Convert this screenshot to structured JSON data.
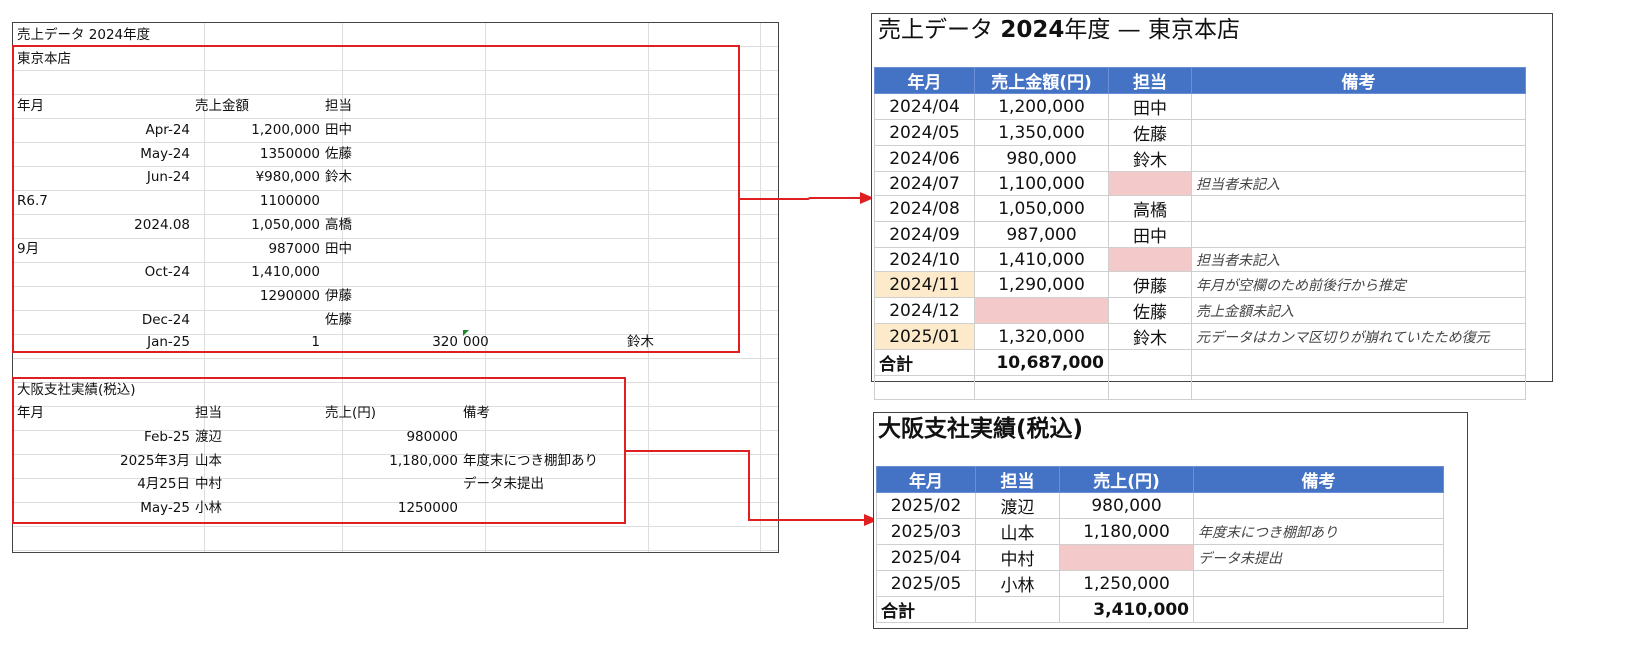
{
  "raw": {
    "title": "売上データ 2024年度",
    "tokyo_label": "東京本店",
    "tokyo_headers": [
      "年月",
      "売上金額",
      "担当"
    ],
    "tokyo_rows": [
      {
        "a": "Apr-24",
        "a_align": "r",
        "b": "1,200,000",
        "c": "田中"
      },
      {
        "a": "May-24",
        "a_align": "r",
        "b": "1350000",
        "c": "佐藤"
      },
      {
        "a": "Jun-24",
        "a_align": "r",
        "b": "¥980,000",
        "c": "鈴木"
      },
      {
        "a": "R6.7",
        "a_align": "l",
        "b": "1100000",
        "c": ""
      },
      {
        "a": "2024.08",
        "a_align": "r",
        "b": "1,050,000",
        "c": "高橋"
      },
      {
        "a": "9月",
        "a_align": "l",
        "b": "987000",
        "c": "田中"
      },
      {
        "a": "Oct-24",
        "a_align": "r",
        "b": "1,410,000",
        "c": ""
      },
      {
        "a": "",
        "a_align": "r",
        "b": "1290000",
        "c": "伊藤"
      },
      {
        "a": "Dec-24",
        "a_align": "r",
        "b": "",
        "c": "佐藤"
      }
    ],
    "jan_row": {
      "a": "Jan-25",
      "b": "1",
      "c": "320",
      "d": "000",
      "e": "鈴木"
    },
    "osaka_label": "大阪支社実績(税込)",
    "osaka_headers": [
      "年月",
      "担当",
      "売上(円)",
      "備考"
    ],
    "osaka_rows": [
      {
        "a": "Feb-25",
        "b": "渡辺",
        "c": "980000",
        "d": ""
      },
      {
        "a": "2025年3月",
        "b": "山本",
        "c": "1,180,000",
        "d": "年度末につき棚卸あり"
      },
      {
        "a": "4月25日",
        "b": "中村",
        "c": "",
        "d": "データ未提出"
      },
      {
        "a": "May-25",
        "b": "小林",
        "c": "1250000",
        "d": ""
      }
    ]
  },
  "tokyo": {
    "title_prefix": "売上データ ",
    "title_bold": "2024",
    "title_suffix": "年度 — 東京本店",
    "headers": [
      "年月",
      "売上金額(円)",
      "担当",
      "備考"
    ],
    "rows": [
      {
        "month": "2024/04",
        "amount": "1,200,000",
        "person": "田中",
        "note": "",
        "mhl": false,
        "ahl": false,
        "phl": false
      },
      {
        "month": "2024/05",
        "amount": "1,350,000",
        "person": "佐藤",
        "note": "",
        "mhl": false,
        "ahl": false,
        "phl": false
      },
      {
        "month": "2024/06",
        "amount": "980,000",
        "person": "鈴木",
        "note": "",
        "mhl": false,
        "ahl": false,
        "phl": false
      },
      {
        "month": "2024/07",
        "amount": "1,100,000",
        "person": "",
        "note": "担当者未記入",
        "mhl": false,
        "ahl": false,
        "phl": true
      },
      {
        "month": "2024/08",
        "amount": "1,050,000",
        "person": "高橋",
        "note": "",
        "mhl": false,
        "ahl": false,
        "phl": false
      },
      {
        "month": "2024/09",
        "amount": "987,000",
        "person": "田中",
        "note": "",
        "mhl": false,
        "ahl": false,
        "phl": false
      },
      {
        "month": "2024/10",
        "amount": "1,410,000",
        "person": "",
        "note": "担当者未記入",
        "mhl": false,
        "ahl": false,
        "phl": true
      },
      {
        "month": "2024/11",
        "amount": "1,290,000",
        "person": "伊藤",
        "note": "年月が空欄のため前後行から推定",
        "mhl": true,
        "ahl": false,
        "phl": false
      },
      {
        "month": "2024/12",
        "amount": "",
        "person": "佐藤",
        "note": "売上金額未記入",
        "mhl": false,
        "ahl": true,
        "phl": false
      },
      {
        "month": "2025/01",
        "amount": "1,320,000",
        "person": "鈴木",
        "note": "元データはカンマ区切りが崩れていたため復元",
        "mhl": true,
        "ahl": false,
        "phl": false
      }
    ],
    "total_label": "合計",
    "total_value": "10,687,000"
  },
  "osaka": {
    "title": "大阪支社実績(税込)",
    "headers": [
      "年月",
      "担当",
      "売上(円)",
      "備考"
    ],
    "rows": [
      {
        "month": "2025/02",
        "person": "渡辺",
        "amount": "980,000",
        "note": "",
        "ahl": false
      },
      {
        "month": "2025/03",
        "person": "山本",
        "amount": "1,180,000",
        "note": "年度末につき棚卸あり",
        "ahl": false
      },
      {
        "month": "2025/04",
        "person": "中村",
        "amount": "",
        "note": "データ未提出",
        "ahl": true
      },
      {
        "month": "2025/05",
        "person": "小林",
        "amount": "1,250,000",
        "note": "",
        "ahl": false
      }
    ],
    "total_label": "合計",
    "total_value": "3,410,000"
  },
  "colors": {
    "header_blue": "#4472c4",
    "missing_pink": "#f4c9c9",
    "estimated_yellow": "#fdeacb",
    "arrow_red": "#e02020"
  }
}
